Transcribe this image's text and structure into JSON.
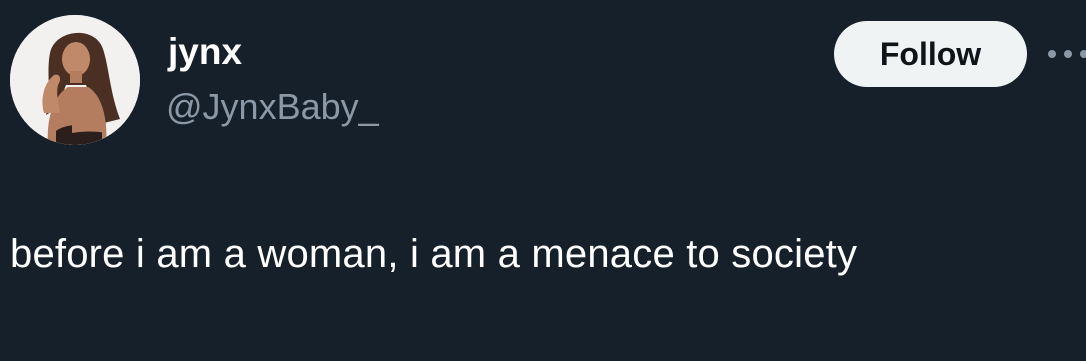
{
  "author": {
    "display_name": "jynx",
    "handle": "@JynxBaby_",
    "avatar_icon": "profile-photo"
  },
  "actions": {
    "follow_label": "Follow",
    "more_icon": "ellipsis-icon"
  },
  "tweet": {
    "text": "before i am a woman, i am a menace to society"
  },
  "colors": {
    "background": "#15202b",
    "primary_text": "#ffffff",
    "secondary_text": "#8b98a5",
    "follow_button_bg": "#eff3f4",
    "follow_button_text": "#0f1419"
  }
}
